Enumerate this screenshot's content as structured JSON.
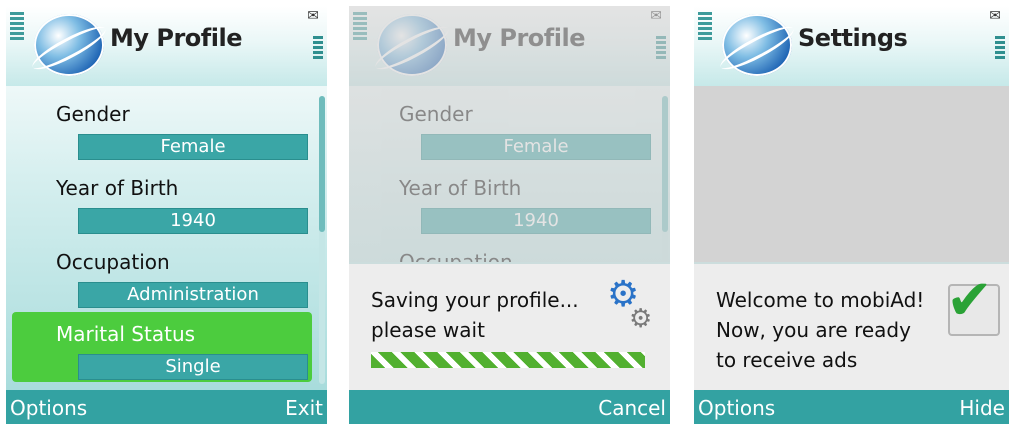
{
  "screen1": {
    "title": "My Profile",
    "fields": [
      {
        "label": "Gender",
        "value": "Female"
      },
      {
        "label": "Year of Birth",
        "value": "1940"
      },
      {
        "label": "Occupation",
        "value": "Administration"
      },
      {
        "label": "Marital Status",
        "value": "Single"
      }
    ],
    "softkeys": {
      "left": "Options",
      "right": "Exit"
    }
  },
  "screen2": {
    "title": "My Profile",
    "fields": [
      {
        "label": "Gender",
        "value": "Female"
      },
      {
        "label": "Year of Birth",
        "value": "1940"
      },
      {
        "label": "Occupation"
      }
    ],
    "dialog": {
      "line1": "Saving your profile...",
      "line2": "please wait"
    },
    "softkeys": {
      "right": "Cancel"
    }
  },
  "screen3": {
    "title": "Settings",
    "dialog": {
      "line1": "Welcome to mobiAd!",
      "line2": "Now, you are ready",
      "line3": "to receive ads"
    },
    "softkeys": {
      "left": "Options",
      "right": "Hide"
    }
  },
  "icons": {
    "signal": "signal-icon",
    "battery": "battery-icon",
    "mail": "mail-icon",
    "logo": "app-logo-icon",
    "gears": "gears-icon",
    "check": "checkmark-icon"
  },
  "colors": {
    "accent": "#33a2a2",
    "field": "#3aa6a6",
    "selected": "#4ccc3e",
    "progress": "#52b030"
  }
}
